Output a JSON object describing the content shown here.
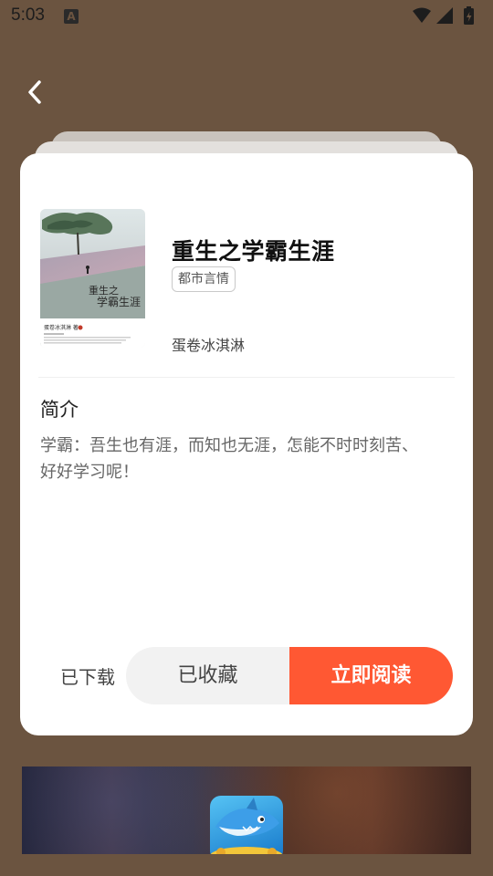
{
  "status": {
    "time": "5:03",
    "notification": "A"
  },
  "book": {
    "title": "重生之学霸生涯",
    "tag": "都市言情",
    "author": "蛋卷冰淇淋",
    "cover": {
      "title_line1": "重生之",
      "title_line2": "学霸生涯",
      "author": "蛋卷冰淇淋 著"
    }
  },
  "intro": {
    "heading": "简介",
    "text": "学霸：吾生也有涯，而知也无涯，怎能不时时刻苦、好好学习呢！"
  },
  "actions": {
    "downloaded": "已下载",
    "favorited": "已收藏",
    "read_now": "立即阅读"
  },
  "colors": {
    "accent": "#ff5833",
    "backdrop": "#6b5440"
  }
}
